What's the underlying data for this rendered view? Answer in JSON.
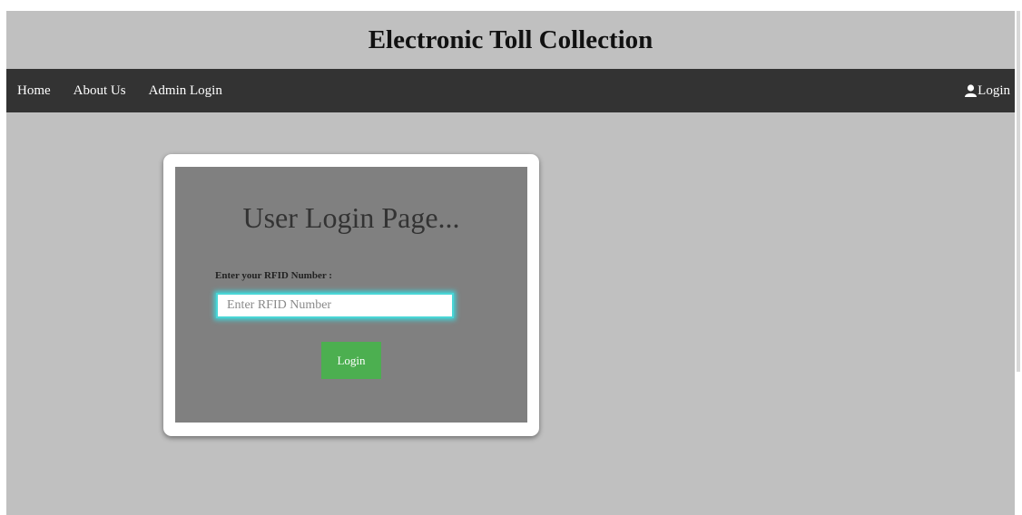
{
  "header": {
    "title": "Electronic Toll Collection"
  },
  "navbar": {
    "items": [
      {
        "label": "Home"
      },
      {
        "label": "About Us"
      },
      {
        "label": "Admin Login"
      }
    ],
    "login_label": "Login",
    "login_icon": "user-icon"
  },
  "login_form": {
    "title": "User Login Page...",
    "rfid_label": "Enter your RFID Number :",
    "rfid_placeholder": "Enter RFID Number",
    "rfid_value": "",
    "submit_label": "Login"
  },
  "colors": {
    "page_background": "#c0c0c0",
    "navbar_background": "#333333",
    "form_background": "#808080",
    "button_background": "#4caf50",
    "input_focus_glow": "#3fd3d8"
  }
}
